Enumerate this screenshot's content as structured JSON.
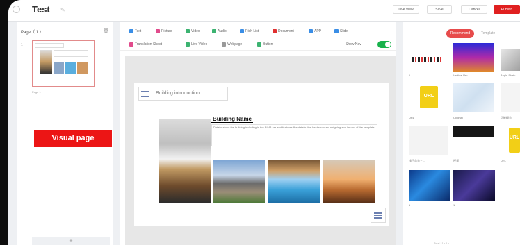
{
  "app": {
    "title": "Test"
  },
  "header": {
    "buttons": [
      {
        "label": "Live View"
      },
      {
        "label": "Save"
      },
      {
        "label": "Cancel"
      },
      {
        "label": "Publish"
      }
    ]
  },
  "pages_panel": {
    "header": "Page（ 1 ）",
    "page_number": "1",
    "thumb_caption": "Page 1",
    "annotation": "Visual page",
    "add_symbol": "+"
  },
  "toolbar": {
    "row1": [
      {
        "label": "Text",
        "color": "#3a8ee6"
      },
      {
        "label": "Picture",
        "color": "#e14b8c"
      },
      {
        "label": "Video",
        "color": "#3cb371"
      },
      {
        "label": "Audio",
        "color": "#3cb371"
      },
      {
        "label": "Rich List",
        "color": "#3a8ee6"
      },
      {
        "label": "Document",
        "color": "#e03030"
      },
      {
        "label": "APP",
        "color": "#3a8ee6"
      },
      {
        "label": "Slide",
        "color": "#3a8ee6"
      }
    ],
    "row2": [
      {
        "label": "Translation Sheet",
        "color": "#e14b8c"
      },
      {
        "label": "Live Video",
        "color": "#3cb371"
      },
      {
        "label": "Webpage",
        "color": "#999999"
      },
      {
        "label": "Button",
        "color": "#3cb371"
      }
    ],
    "toggle_label": "Show Nav",
    "toggle_on": true
  },
  "canvas": {
    "nav_title": "Building introduction",
    "building_name": "Building Name",
    "description": "Details about the building including in the BIMA are and features like details that best show an intriguing and impact of the template"
  },
  "assets_panel": {
    "tabs": {
      "active": "Recommend",
      "inactive": "Template"
    },
    "items": [
      {
        "label": "1"
      },
      {
        "label": "Vertical Pro..."
      },
      {
        "label": "Angle Sketc..."
      },
      {
        "label": "URL"
      },
      {
        "label": "Optimal"
      },
      {
        "label": "功能概览"
      },
      {
        "label": "排行总览三..."
      },
      {
        "label": "视频"
      },
      {
        "label": "URL"
      },
      {
        "label": "1"
      },
      {
        "label": "1"
      }
    ],
    "url_badge": "URL",
    "pager": "Total 11    ‹  1  ›"
  }
}
